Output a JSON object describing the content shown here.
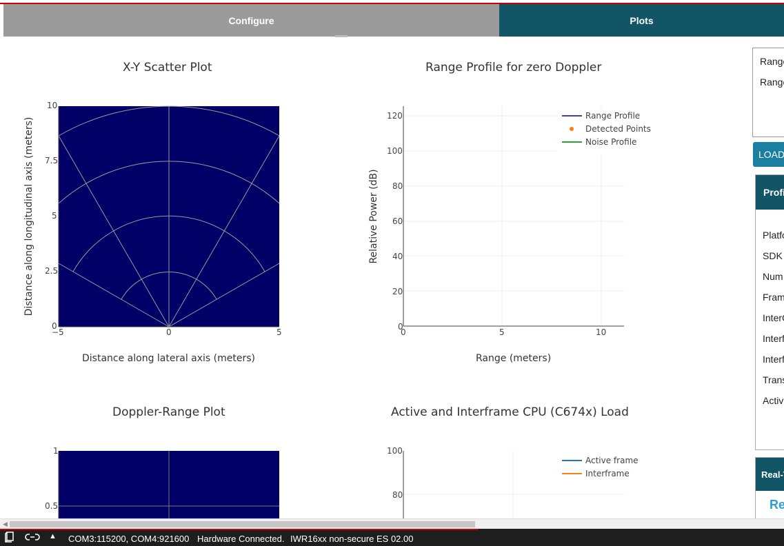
{
  "tabs": [
    {
      "label": "Configure"
    },
    {
      "label": "Plots"
    }
  ],
  "plots": {
    "scatter": {
      "title": "X-Y Scatter Plot",
      "xlabel": "Distance along lateral axis (meters)",
      "ylabel": "Distance along longitudinal axis (meters)",
      "xticks": [
        "−5",
        "0",
        "5"
      ],
      "yticks": [
        "0",
        "2.5",
        "5",
        "7.5",
        "10"
      ],
      "bg_color": "#000066"
    },
    "range_profile": {
      "title": "Range Profile for zero Doppler",
      "xlabel": "Range (meters)",
      "ylabel": "Relative Power (dB)",
      "xticks": [
        "0",
        "5",
        "10"
      ],
      "yticks": [
        "0",
        "20",
        "40",
        "60",
        "80",
        "100",
        "120"
      ],
      "legend": [
        "Range Profile",
        "Detected Points",
        "Noise Profile"
      ],
      "legend_colors": [
        "#000080",
        "#ff7f0e",
        "#2ca02c"
      ]
    },
    "doppler_range": {
      "title": "Doppler-Range Plot",
      "yticks": [
        "1",
        "0.5"
      ],
      "bg_color": "#000066"
    },
    "cpu_load": {
      "title": "Active and Interframe  CPU (C674x) Load",
      "yticks": [
        "100",
        "80"
      ],
      "legend": [
        "Active frame",
        "Interframe"
      ],
      "legend_colors": [
        "#1f77b4",
        "#ff7f0e"
      ]
    }
  },
  "chart_data": [
    {
      "type": "scatter",
      "title": "X-Y Scatter Plot",
      "xlabel": "Distance along lateral axis (meters)",
      "ylabel": "Distance along longitudinal axis (meters)",
      "xlim": [
        -5,
        5
      ],
      "ylim": [
        0,
        10
      ],
      "series": []
    },
    {
      "type": "line",
      "title": "Range Profile for zero Doppler",
      "xlabel": "Range (meters)",
      "ylabel": "Relative Power (dB)",
      "xlim": [
        0,
        11.2
      ],
      "ylim": [
        0,
        125
      ],
      "series": [
        {
          "name": "Range Profile",
          "values": []
        },
        {
          "name": "Detected Points",
          "values": []
        },
        {
          "name": "Noise Profile",
          "values": []
        }
      ]
    },
    {
      "type": "heatmap",
      "title": "Doppler-Range Plot",
      "ylim": [
        0,
        1
      ]
    },
    {
      "type": "line",
      "title": "Active and Interframe  CPU (C674x) Load",
      "ylim": [
        0,
        100
      ],
      "series": [
        {
          "name": "Active frame",
          "values": []
        },
        {
          "name": "Interframe",
          "values": []
        }
      ]
    }
  ],
  "right_panel": {
    "lines": [
      "Range",
      "Range"
    ],
    "load_button": "LOAD",
    "profile_header": "Profi",
    "profile_rows": [
      "Platfo",
      "SDK V",
      "Num",
      "Fram",
      "InterC",
      "Interf",
      "Interf",
      "Trans",
      "Activ"
    ],
    "realtime_header": "Real-T",
    "realtime_link": "Re"
  },
  "status": {
    "ports": "COM3:115200, COM4:921600",
    "connection": "Hardware Connected.",
    "device": "IWR16xx non-secure ES 02.00",
    "progress": 0.61
  }
}
